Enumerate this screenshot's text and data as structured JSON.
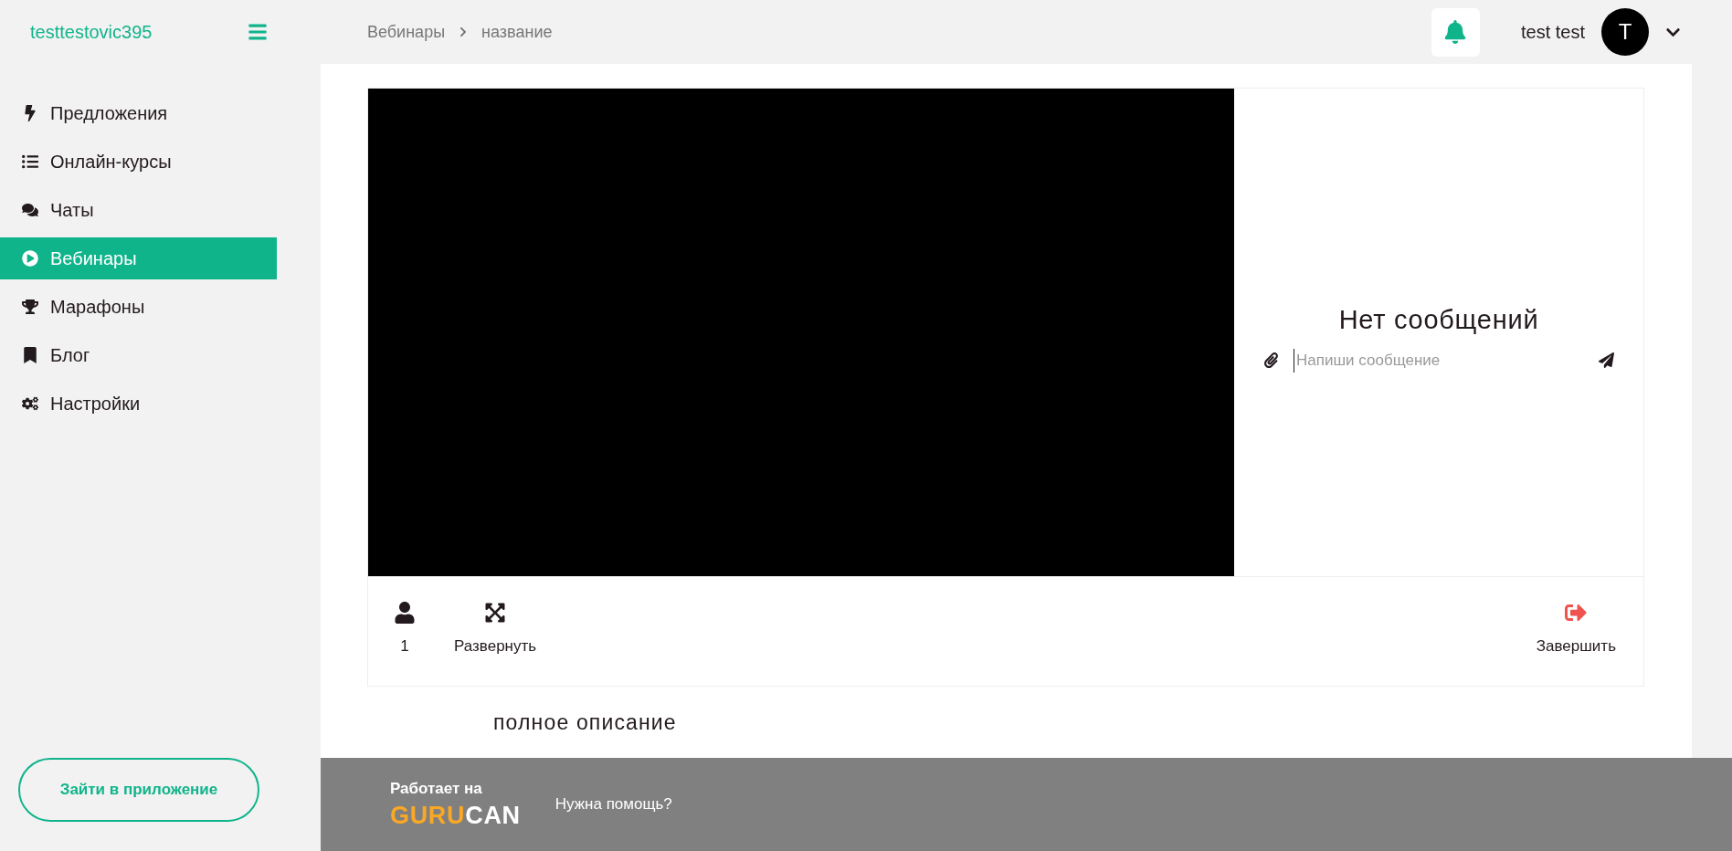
{
  "sidebar": {
    "brand": "testtestovic395",
    "items": [
      {
        "label": "Предложения",
        "selected": false
      },
      {
        "label": "Онлайн-курсы",
        "selected": false
      },
      {
        "label": "Чаты",
        "selected": false
      },
      {
        "label": "Вебинары",
        "selected": true
      },
      {
        "label": "Марафоны",
        "selected": false
      },
      {
        "label": "Блог",
        "selected": false
      },
      {
        "label": "Настройки",
        "selected": false
      }
    ],
    "app_button": "Зайти в приложение"
  },
  "header": {
    "breadcrumbs": [
      "Вебинары",
      "название"
    ],
    "user_name": "test test",
    "avatar_letter": "T"
  },
  "webinar": {
    "chat": {
      "empty_text": "Нет сообщений",
      "input_placeholder": "Напиши сообщение"
    },
    "controls": [
      {
        "kind": "viewers",
        "label": "1"
      },
      {
        "kind": "expand",
        "label": "Развернуть"
      },
      {
        "kind": "finish",
        "label": "Завершить"
      }
    ],
    "description": "полное описание"
  },
  "footer": {
    "powered_by": "Работает на",
    "logo_accent": "GURU",
    "logo_rest": "CAN",
    "help_link": "Нужна помощь?"
  }
}
